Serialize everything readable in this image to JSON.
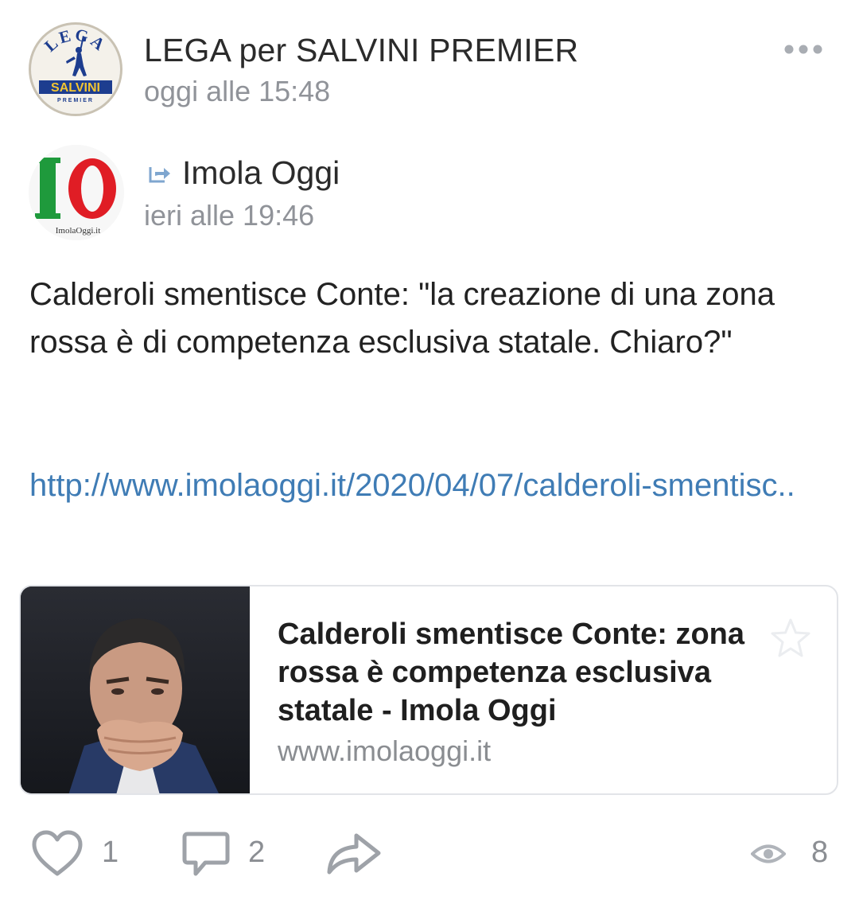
{
  "post": {
    "author_name": "LEGA per SALVINI PREMIER",
    "timestamp": "oggi alle 15:48",
    "avatar_text_top": "LEGA",
    "avatar_text_band": "SALVINI",
    "avatar_text_bottom": "PREMIER",
    "more_icon": "more-dots-icon"
  },
  "repost": {
    "source_name": "Imola Oggi",
    "timestamp": "ieri alle 19:46",
    "avatar_logo": "IO",
    "avatar_caption": "ImolaOggi.it",
    "repost_icon": "share-arrow-icon"
  },
  "content": {
    "text": "Calderoli smentisce Conte: \"la creazione di una zona rossa è di competenza esclusiva statale. Chiaro?\"",
    "link": "http://www.imolaoggi.it/2020/04/07/calderoli-smentisc.."
  },
  "link_card": {
    "title": "Calderoli smentisce Conte: zona rossa è competenza esclusiva statale - Imola Oggi",
    "domain": "www.imolaoggi.it",
    "image": "photo-thumbnail",
    "star_icon": "star-icon"
  },
  "actions": {
    "likes": "1",
    "comments": "2",
    "views": "8",
    "like_icon": "heart-icon",
    "comment_icon": "comment-icon",
    "share_icon": "share-icon",
    "views_icon": "eye-icon"
  },
  "colors": {
    "link": "#3f7cb5",
    "secondary_text": "#909399",
    "primary_text": "#222222",
    "icon": "#9ea2a8",
    "lega_blue": "#1d3d8f",
    "lega_yellow": "#f2c531",
    "imola_green": "#1f9a3c",
    "imola_red": "#e01d25"
  }
}
